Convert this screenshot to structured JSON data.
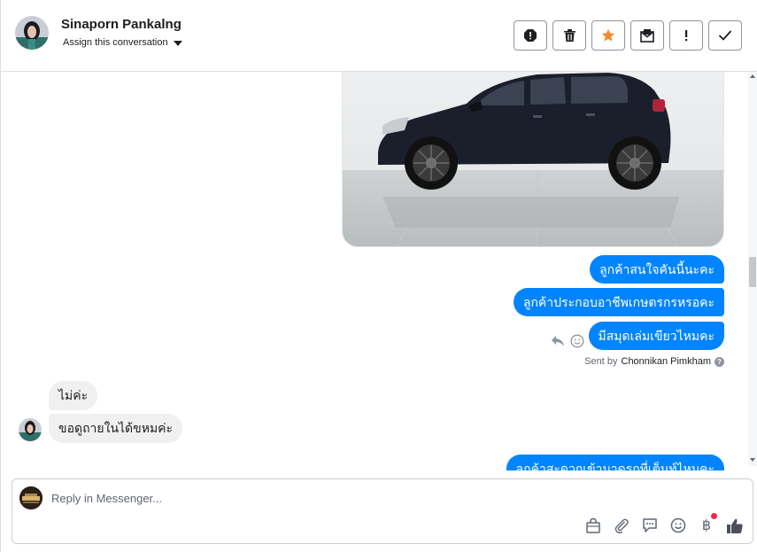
{
  "header": {
    "contact_name": "Sinaporn Pankalng",
    "assign_label": "Assign this conversation",
    "actions": [
      "spam-icon",
      "trash-icon",
      "star-icon",
      "mark-unread-icon",
      "follow-up-icon",
      "done-icon"
    ],
    "star_color": "#f38b24"
  },
  "conversation": {
    "outgoing": [
      "ลูกค้าสนใจคันนี้นะคะ",
      "ลูกค้าประกอบอาชีพเกษตรกรหรอคะ",
      "มีสมุดเล่มเขียวไหมคะ"
    ],
    "outgoing_partial": "ลูกค้าสะดวกเข้ามาดูรถที่เต็นท์ไหมคะ",
    "sent_by_prefix": "Sent by",
    "sent_by_name": "Chonnikan Pimkham",
    "incoming": [
      "ไม่ค่ะ",
      "ขอดูถายในได้ขหมค่ะ"
    ],
    "bubble_color": "#0084ff"
  },
  "composer": {
    "placeholder": "Reply in Messenger...",
    "tools": [
      "shopping-bag-icon",
      "attachment-icon",
      "saved-reply-icon",
      "emoji-icon",
      "payment-icon",
      "like-icon"
    ],
    "payment_symbol": "฿"
  }
}
